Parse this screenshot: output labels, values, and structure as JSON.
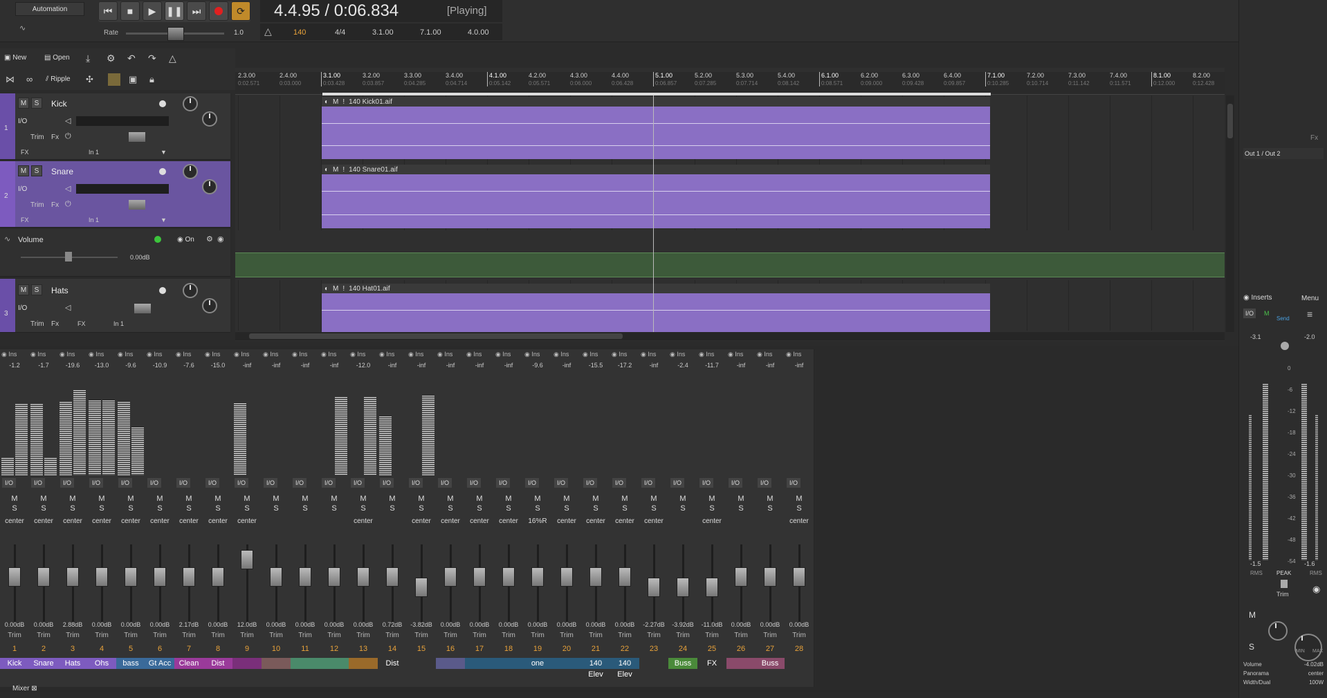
{
  "transport": {
    "automation_label": "Automation",
    "rate_label": "Rate",
    "rate_value": "1.0",
    "position": "4.4.95 / 0:06.834",
    "state": "[Playing]",
    "tempo": "140",
    "time_sig": "4/4",
    "loop_start": "3.1.00",
    "loop_end": "7.1.00",
    "loop_length": "4.0.00"
  },
  "toolbar": {
    "new_label": "New",
    "open_label": "Open",
    "ripple_label": "Ripple"
  },
  "ruler": [
    {
      "bar": "2.3.00",
      "time": "0:02.571"
    },
    {
      "bar": "2.4.00",
      "time": "0:03.000"
    },
    {
      "bar": "3.1.00",
      "time": "0:03.428"
    },
    {
      "bar": "3.2.00",
      "time": "0:03.857"
    },
    {
      "bar": "3.3.00",
      "time": "0:04.285"
    },
    {
      "bar": "3.4.00",
      "time": "0:04.714"
    },
    {
      "bar": "4.1.00",
      "time": "0:05.142"
    },
    {
      "bar": "4.2.00",
      "time": "0:05.571"
    },
    {
      "bar": "4.3.00",
      "time": "0:06.000"
    },
    {
      "bar": "4.4.00",
      "time": "0:06.428"
    },
    {
      "bar": "5.1.00",
      "time": "0:06.857"
    },
    {
      "bar": "5.2.00",
      "time": "0:07.285"
    },
    {
      "bar": "5.3.00",
      "time": "0:07.714"
    },
    {
      "bar": "5.4.00",
      "time": "0:08.142"
    },
    {
      "bar": "6.1.00",
      "time": "0:08.571"
    },
    {
      "bar": "6.2.00",
      "time": "0:09.000"
    },
    {
      "bar": "6.3.00",
      "time": "0:09.428"
    },
    {
      "bar": "6.4.00",
      "time": "0:09.857"
    },
    {
      "bar": "7.1.00",
      "time": "0:10.285"
    },
    {
      "bar": "7.2.00",
      "time": "0:10.714"
    },
    {
      "bar": "7.3.00",
      "time": "0:11.142"
    },
    {
      "bar": "7.4.00",
      "time": "0:11.571"
    },
    {
      "bar": "8.1.00",
      "time": "0:12.000"
    },
    {
      "bar": "8.2.00",
      "time": "0:12.428"
    }
  ],
  "tracks": [
    {
      "number": "1",
      "name": "Kick",
      "input": "In 1",
      "fx": "FX",
      "trim": "Trim",
      "fx_btn": "Fx",
      "io": "I/O",
      "clip": "140 Kick01.aif"
    },
    {
      "number": "2",
      "name": "Snare",
      "input": "In 1",
      "fx": "FX",
      "trim": "Trim",
      "fx_btn": "Fx",
      "io": "I/O",
      "clip": "140 Snare01.aif"
    },
    {
      "number": "3",
      "name": "Hats",
      "input": "In 1",
      "fx": "FX",
      "trim": "Trim",
      "fx_btn": "Fx",
      "io": "I/O",
      "clip": "140 Hat01.aif"
    }
  ],
  "automation_lane": {
    "label": "Volume",
    "on_label": "On",
    "value": "0.00dB"
  },
  "mixer": {
    "tab_label": "Mixer",
    "ins_label": "Ins",
    "io_label": "I/O",
    "m_label": "M",
    "s_label": "S",
    "trim_label": "Trim",
    "fx_label": "Fx",
    "in1_label": "In 1",
    "strips": [
      {
        "num": "1",
        "name": "Kick",
        "peak": "-1.2",
        "pan": "center",
        "db": "0.00dB",
        "color": "#7d5bbf"
      },
      {
        "num": "2",
        "name": "Snare",
        "peak": "-1.7",
        "pan": "center",
        "db": "0.00dB",
        "color": "#7d5bbf"
      },
      {
        "num": "3",
        "name": "Hats",
        "peak": "-19.6",
        "pan": "center",
        "db": "2.88dB",
        "color": "#7d5bbf"
      },
      {
        "num": "4",
        "name": "Ohs",
        "peak": "-13.0",
        "pan": "center",
        "db": "0.00dB",
        "color": "#7d5bbf"
      },
      {
        "num": "5",
        "name": "bass",
        "peak": "-9.6",
        "pan": "center",
        "db": "0.00dB",
        "color": "#3a6a9a"
      },
      {
        "num": "6",
        "name": "Gt Acc",
        "peak": "-10.9",
        "pan": "center",
        "db": "0.00dB",
        "color": "#3a6a9a"
      },
      {
        "num": "7",
        "name": "Clean",
        "peak": "-7.6",
        "pan": "center",
        "db": "2.17dB",
        "color": "#9a3a9a"
      },
      {
        "num": "8",
        "name": "Dist",
        "peak": "-15.0",
        "pan": "center",
        "db": "0.00dB",
        "color": "#9a3a9a"
      },
      {
        "num": "9",
        "name": "",
        "peak": "-inf",
        "pan": "center",
        "db": "12.0dB",
        "color": "#7a2f7a"
      },
      {
        "num": "10",
        "name": "",
        "peak": "-inf",
        "pan": "",
        "db": "0.00dB",
        "color": "#7a5a5a"
      },
      {
        "num": "11",
        "name": "",
        "peak": "-inf",
        "pan": "",
        "db": "0.00dB",
        "color": "#4a8a6a"
      },
      {
        "num": "12",
        "name": "",
        "peak": "-inf",
        "pan": "",
        "db": "0.00dB",
        "color": "#4a8a6a"
      },
      {
        "num": "13",
        "name": "",
        "peak": "-12.0",
        "pan": "center",
        "db": "0.00dB",
        "color": "#9a6a2a"
      },
      {
        "num": "14",
        "name": "Dist",
        "peak": "-inf",
        "pan": "",
        "db": "0.72dB",
        "color": "#333333"
      },
      {
        "num": "15",
        "name": "",
        "peak": "-inf",
        "pan": "center",
        "db": "-3.82dB",
        "color": "#333333"
      },
      {
        "num": "16",
        "name": "",
        "peak": "-inf",
        "pan": "center",
        "db": "0.00dB",
        "color": "#5a5a8a"
      },
      {
        "num": "17",
        "name": "",
        "peak": "-inf",
        "pan": "center",
        "db": "0.00dB",
        "color": "#2a5a7a"
      },
      {
        "num": "18",
        "name": "",
        "peak": "-inf",
        "pan": "center",
        "db": "0.00dB",
        "color": "#2a5a7a"
      },
      {
        "num": "19",
        "name": "one",
        "peak": "-9.6",
        "pan": "16%R",
        "db": "0.00dB",
        "color": "#2a5a7a"
      },
      {
        "num": "20",
        "name": "",
        "peak": "-inf",
        "pan": "center",
        "db": "0.00dB",
        "color": "#2a5a7a"
      },
      {
        "num": "21",
        "name": "140 Elev",
        "peak": "-15.5",
        "pan": "center",
        "db": "0.00dB",
        "color": "#2a5a7a"
      },
      {
        "num": "22",
        "name": "140 Elev",
        "peak": "-17.2",
        "pan": "center",
        "db": "0.00dB",
        "color": "#2a5a7a"
      },
      {
        "num": "23",
        "name": "",
        "peak": "-inf",
        "pan": "center",
        "db": "-2.27dB",
        "color": "#333333"
      },
      {
        "num": "24",
        "name": "Buss",
        "peak": "-2.4",
        "pan": "",
        "db": "-3.92dB",
        "color": "#4a8a3a"
      },
      {
        "num": "25",
        "name": "FX",
        "peak": "-11.7",
        "pan": "center",
        "db": "-11.0dB",
        "color": "#333333"
      },
      {
        "num": "26",
        "name": "",
        "peak": "-inf",
        "pan": "",
        "db": "0.00dB",
        "color": "#8a4a6a"
      },
      {
        "num": "27",
        "name": "Buss",
        "peak": "-inf",
        "pan": "",
        "db": "0.00dB",
        "color": "#8a4a6a"
      },
      {
        "num": "28",
        "name": "",
        "peak": "-inf",
        "pan": "center",
        "db": "0.00dB",
        "color": "#333333"
      }
    ],
    "meter_levels": [
      0.2,
      0.82,
      0.82,
      0.2,
      0.85,
      0.98,
      0.86,
      0.86,
      0.85,
      0.55,
      0,
      0,
      0,
      0,
      0,
      0,
      0.83,
      0,
      0,
      0,
      0,
      0,
      0,
      0.9,
      0,
      0.9,
      0.68,
      0,
      0,
      0.92,
      0,
      0,
      0,
      0,
      0,
      0,
      0,
      0,
      0,
      0,
      0,
      0,
      0,
      0,
      0,
      0,
      0,
      0,
      0,
      0,
      0,
      0,
      0,
      0,
      0,
      0
    ]
  },
  "right_panel": {
    "fx_label": "Fx",
    "output": "Out 1 / Out 2",
    "inserts_label": "Inserts",
    "menu_label": "Menu",
    "io_label": "I/O",
    "m_label": "M",
    "send_label": "Send",
    "peak_left": "-3.1",
    "peak_right": "-2.0",
    "scale": [
      "0",
      "-6",
      "-12",
      "-18",
      "-24",
      "-30",
      "-36",
      "-42",
      "-48",
      "-54"
    ],
    "low_left": "-1.5",
    "low_right": "-1.6",
    "rms_label": "RMS",
    "peak_label": "PEAK",
    "trim_label": "Trim",
    "s_label": "S",
    "min_label": "MIN",
    "max_label": "MAX",
    "volume_label": "Volume",
    "volume_value": "-4.02dB",
    "panorama_label": "Panorama",
    "panorama_value": "center",
    "width_label": "Width/Dual",
    "width_value": "100W"
  }
}
